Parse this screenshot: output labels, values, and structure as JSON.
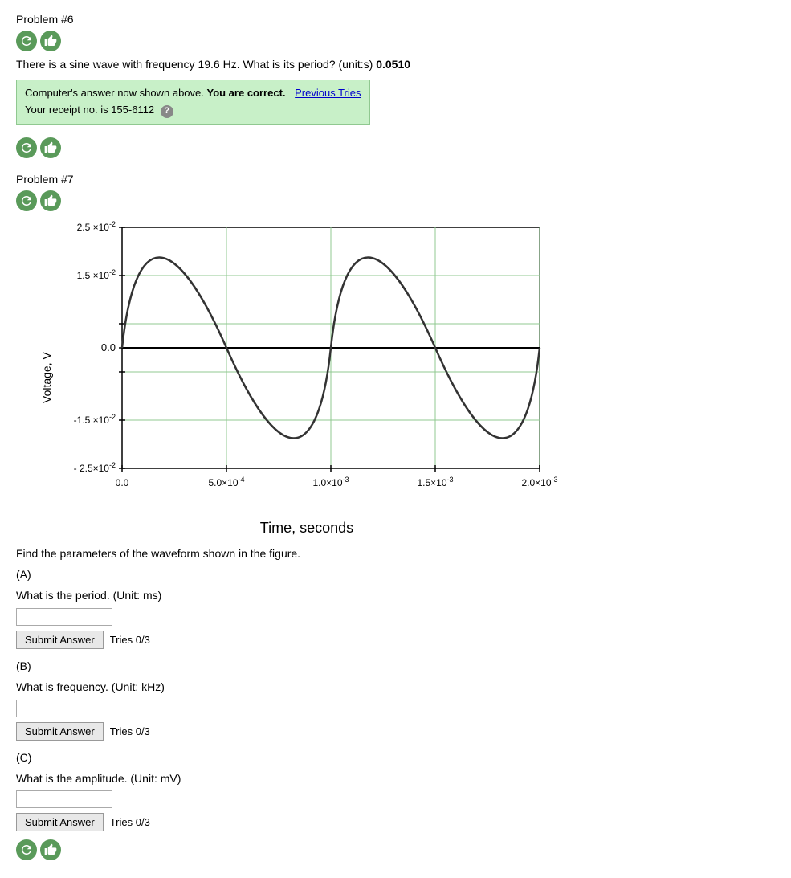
{
  "problem6": {
    "title": "Problem #6",
    "question_text": "There is a sine wave with frequency 19.6 Hz. What is its period? (unit:s)",
    "answer": "0.0510",
    "banner": {
      "line1": "Computer's answer now shown above.",
      "correct_text": "You are correct.",
      "line2": "Your receipt no. is 155-6112",
      "previous_tries_link": "Previous Tries"
    }
  },
  "problem7": {
    "title": "Problem #7",
    "figure_caption": "Find the parameters of the waveform shown in the figure.",
    "sub_a_label": "(A)",
    "sub_a_question": "What is the period. (Unit: ms)",
    "sub_b_label": "(B)",
    "sub_b_question": "What is frequency. (Unit: kHz)",
    "sub_c_label": "(C)",
    "sub_c_question": "What is the amplitude. (Unit: mV)",
    "submit_label": "Submit Answer",
    "tries_a": "Tries 0/3",
    "tries_b": "Tries 0/3",
    "tries_c": "Tries 0/3",
    "y_axis_label": "Voltage, V",
    "x_axis_label": "Time, seconds",
    "y_ticks": [
      "2.5 ×10⁻²",
      "1.5 ×10⁻²",
      "0.0",
      "-1.5 ×10⁻²",
      "- 2.5×10⁻²"
    ],
    "x_ticks": [
      "0.0",
      "5.0×10⁻⁴",
      "1.0×10⁻³",
      "1.5×10⁻³",
      "2.0×10⁻³"
    ]
  },
  "icons": {
    "refresh": "↺",
    "thumb": "👍",
    "help": "?"
  }
}
